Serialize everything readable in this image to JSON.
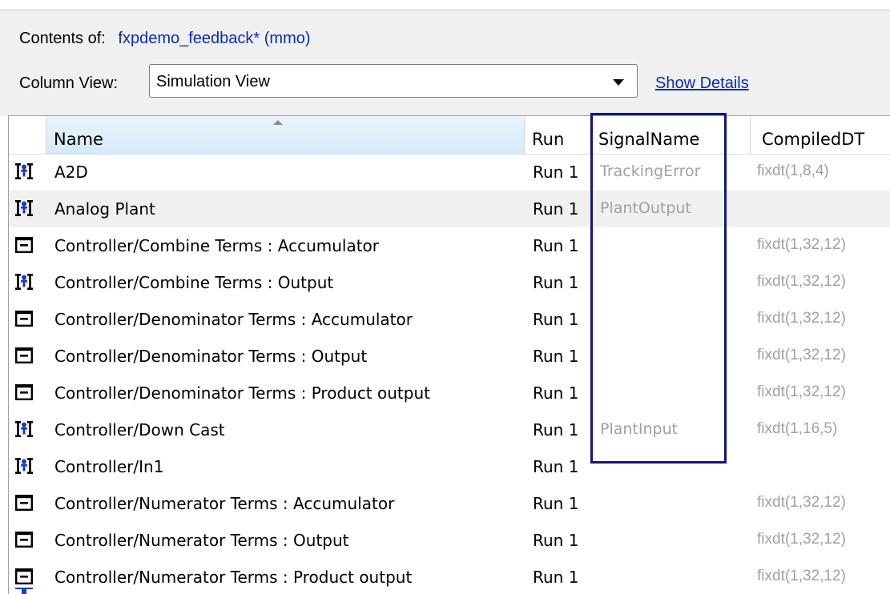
{
  "header": {
    "contents_label": "Contents of:",
    "contents_value": "fxpdemo_feedback* (mmo)",
    "column_view_label": "Column View:",
    "column_view_value": "Simulation View",
    "show_details": "Show Details"
  },
  "table": {
    "columns": {
      "name": "Name",
      "run": "Run",
      "signal": "SignalName",
      "dt": "CompiledDT"
    },
    "sorted_column": "Name",
    "rows": [
      {
        "icon": "signal-icon",
        "name": "A2D",
        "run": "Run 1",
        "signal": "TrackingError",
        "dt": "fixdt(1,8,4)"
      },
      {
        "icon": "signal-icon",
        "name": "Analog Plant",
        "run": "Run 1",
        "signal": "PlantOutput",
        "dt": "",
        "selected": true
      },
      {
        "icon": "accumulator-icon",
        "name": "Controller/Combine Terms : Accumulator",
        "run": "Run 1",
        "signal": "",
        "dt": "fixdt(1,32,12)"
      },
      {
        "icon": "signal-icon",
        "name": "Controller/Combine Terms : Output",
        "run": "Run 1",
        "signal": "",
        "dt": "fixdt(1,32,12)"
      },
      {
        "icon": "accumulator-icon",
        "name": "Controller/Denominator Terms : Accumulator",
        "run": "Run 1",
        "signal": "",
        "dt": "fixdt(1,32,12)"
      },
      {
        "icon": "accumulator-icon",
        "name": "Controller/Denominator Terms : Output",
        "run": "Run 1",
        "signal": "",
        "dt": "fixdt(1,32,12)"
      },
      {
        "icon": "accumulator-icon",
        "name": "Controller/Denominator Terms : Product output",
        "run": "Run 1",
        "signal": "",
        "dt": "fixdt(1,32,12)"
      },
      {
        "icon": "signal-icon",
        "name": "Controller/Down Cast",
        "run": "Run 1",
        "signal": "PlantInput",
        "dt": "fixdt(1,16,5)"
      },
      {
        "icon": "signal-icon",
        "name": "Controller/In1",
        "run": "Run 1",
        "signal": "",
        "dt": ""
      },
      {
        "icon": "accumulator-icon",
        "name": "Controller/Numerator Terms : Accumulator",
        "run": "Run 1",
        "signal": "",
        "dt": "fixdt(1,32,12)"
      },
      {
        "icon": "accumulator-icon",
        "name": "Controller/Numerator Terms : Output",
        "run": "Run 1",
        "signal": "",
        "dt": "fixdt(1,32,12)"
      },
      {
        "icon": "accumulator-icon",
        "name": "Controller/Numerator Terms : Product output",
        "run": "Run 1",
        "signal": "",
        "dt": "fixdt(1,32,12)"
      }
    ]
  },
  "colors": {
    "link": "#0b2cb0",
    "highlight_box": "#14167d",
    "signal_icon": "#1a3cc8",
    "muted_text": "#a0a0a0"
  }
}
